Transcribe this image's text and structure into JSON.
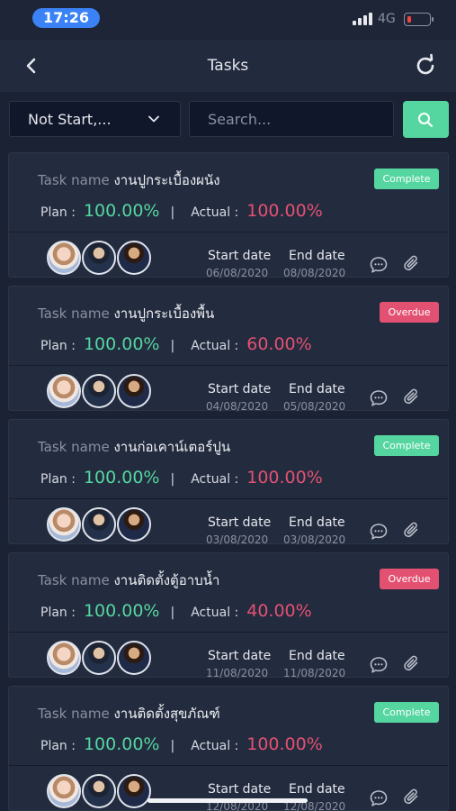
{
  "status_bar": {
    "time": "17:26",
    "network": "4G",
    "signal_icon": "signal-bars-icon",
    "battery_icon": "battery-low-icon"
  },
  "header": {
    "title": "Tasks",
    "back_icon": "chevron-left-icon",
    "refresh_icon": "refresh-icon"
  },
  "filters": {
    "status_select": "Not Start,...",
    "search_placeholder": "Search...",
    "search_icon": "search-icon"
  },
  "colors": {
    "accent_green": "#55d6a0",
    "accent_red": "#e35172",
    "background": "#1b2233",
    "card": "#232b3e"
  },
  "labels": {
    "task_name": "Task name",
    "plan": "Plan :",
    "separator": "|",
    "actual": "Actual :",
    "start_date": "Start date",
    "end_date": "End date"
  },
  "tasks": [
    {
      "name": "งานปูกระเบื้องผนัง",
      "status": "Complete",
      "plan": "100.00%",
      "actual": "100.00%",
      "start_date": "06/08/2020",
      "end_date": "08/08/2020"
    },
    {
      "name": "งานปูกระเบื้องพื้น",
      "status": "Overdue",
      "plan": "100.00%",
      "actual": "60.00%",
      "start_date": "04/08/2020",
      "end_date": "05/08/2020"
    },
    {
      "name": "งานก่อเคาน์เตอร์ปูน",
      "status": "Complete",
      "plan": "100.00%",
      "actual": "100.00%",
      "start_date": "03/08/2020",
      "end_date": "03/08/2020"
    },
    {
      "name": "งานติดตั้งตู้อาบน้ำ",
      "status": "Overdue",
      "plan": "100.00%",
      "actual": "40.00%",
      "start_date": "11/08/2020",
      "end_date": "11/08/2020"
    },
    {
      "name": "งานติดตั้งสุขภัณฑ์",
      "status": "Complete",
      "plan": "100.00%",
      "actual": "100.00%",
      "start_date": "12/08/2020",
      "end_date": "12/08/2020"
    }
  ]
}
